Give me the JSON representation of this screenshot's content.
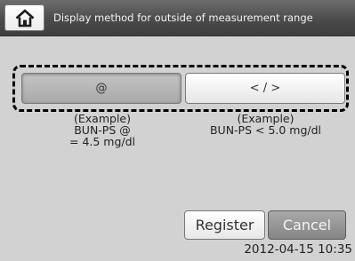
{
  "header": {
    "title": "Display method for outside of measurement range",
    "home_icon": "home-icon"
  },
  "options": {
    "at": {
      "label": "@",
      "selected": true
    },
    "lt": {
      "label": "< / >",
      "selected": false
    }
  },
  "examples": {
    "at": {
      "heading": "(Example)",
      "line1": "BUN-PS @",
      "line2": "= 4.5 mg/dl"
    },
    "lt": {
      "heading": "(Example)",
      "line1": "BUN-PS < 5.0 mg/dl"
    }
  },
  "actions": {
    "register_label": "Register",
    "cancel_label": "Cancel"
  },
  "status": {
    "datetime": "2012-04-15 10:35"
  },
  "colors": {
    "header_bg": "#4b4b4b",
    "screen_bg": "#d2d2d2",
    "selected_option": "#a9a9a9",
    "cancel_button": "#858585"
  }
}
